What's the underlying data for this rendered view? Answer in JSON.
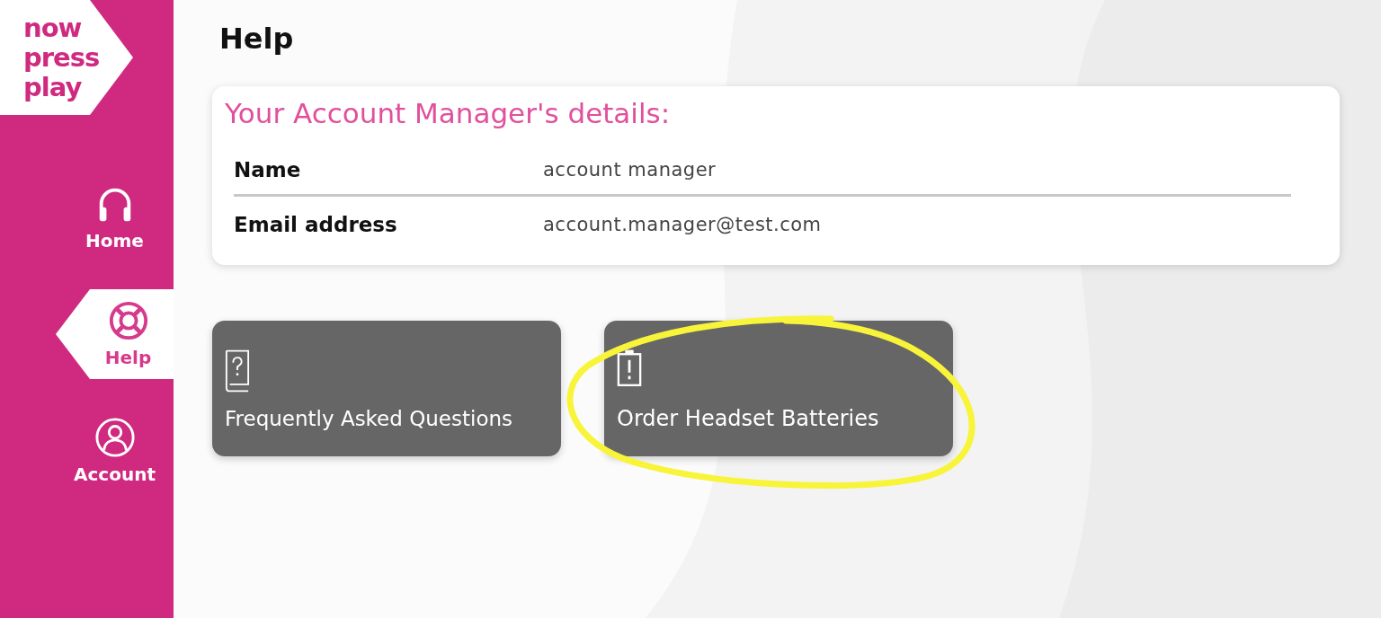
{
  "logo": [
    "now",
    "press",
    "play"
  ],
  "nav": [
    {
      "label": "Home",
      "selected": false
    },
    {
      "label": "Help",
      "selected": true
    },
    {
      "label": "Account",
      "selected": false
    }
  ],
  "page_title": "Help",
  "account_card": {
    "heading": "Your Account Manager's details:",
    "rows": [
      {
        "label": "Name",
        "value": "account manager"
      },
      {
        "label": "Email address",
        "value": "account.manager@test.com"
      }
    ]
  },
  "tiles": [
    {
      "label": "Frequently Asked Questions",
      "circled": false
    },
    {
      "label": "Order Headset Batteries",
      "circled": true
    }
  ]
}
